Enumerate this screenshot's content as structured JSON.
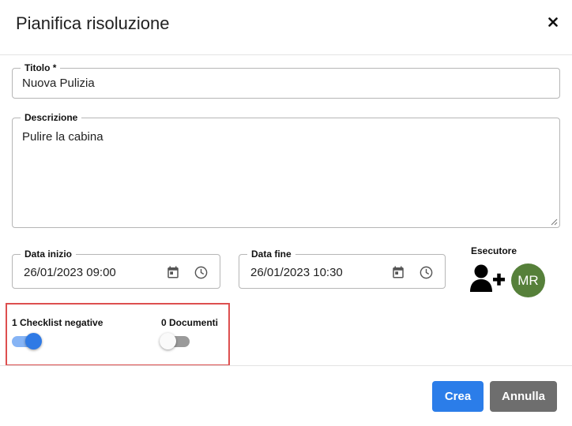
{
  "dialog": {
    "title": "Pianifica risoluzione",
    "close_icon": "close-icon"
  },
  "form": {
    "titolo": {
      "label": "Titolo *",
      "value": "Nuova Pulizia"
    },
    "descrizione": {
      "label": "Descrizione",
      "value": "Pulire la cabina"
    },
    "data_inizio": {
      "label": "Data inizio",
      "value": "26/01/2023 09:00",
      "icons": [
        "calendar-icon",
        "clock-icon"
      ]
    },
    "data_fine": {
      "label": "Data fine",
      "value": "26/01/2023 10:30",
      "icons": [
        "calendar-icon",
        "clock-icon"
      ]
    },
    "esecutore": {
      "label": "Esecutore",
      "add_icon": "add-user-icon",
      "avatar_initials": "MR",
      "avatar_color": "#56803a"
    }
  },
  "toggles": [
    {
      "label": "1 Checklist negative",
      "on": true
    },
    {
      "label": "0 Documenti",
      "on": false
    }
  ],
  "footer": {
    "crea_label": "Crea",
    "annulla_label": "Annulla"
  },
  "colors": {
    "primary": "#2b7de9",
    "secondary": "#6e6e6e",
    "highlight": "#dd4f4f"
  }
}
